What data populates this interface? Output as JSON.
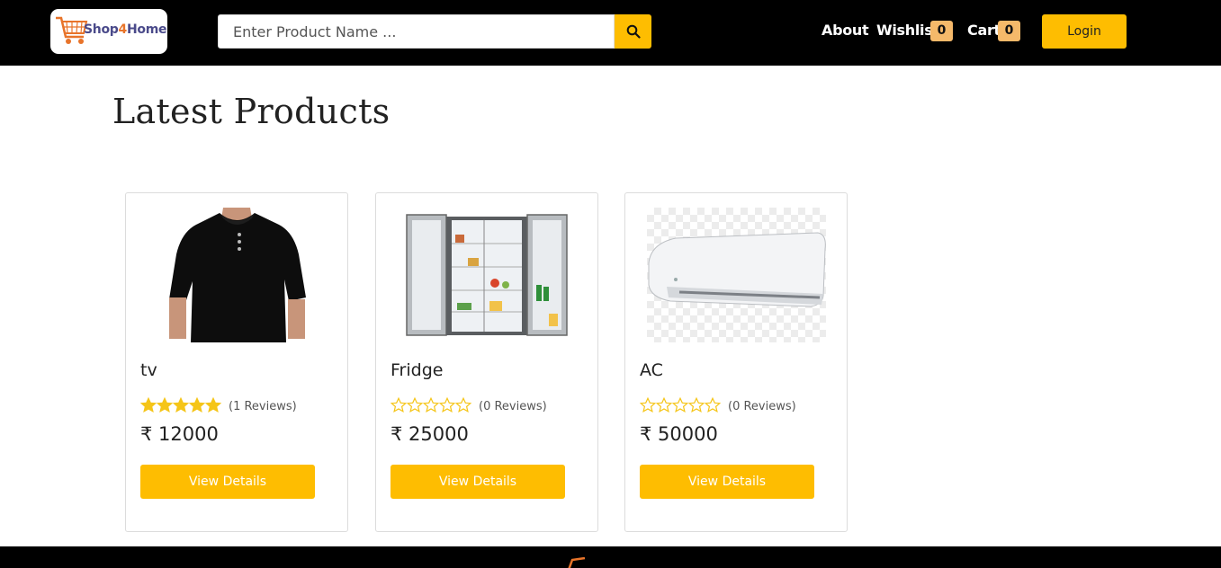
{
  "header": {
    "logo_text_a": "Shop",
    "logo_text_b": "4",
    "logo_text_c": "Home",
    "search_placeholder": "Enter Product Name ...",
    "nav": {
      "about": "About",
      "wishlist": "Wishlist",
      "wishlist_count": "0",
      "cart": "Cart",
      "cart_count": "0",
      "login": "Login"
    }
  },
  "main": {
    "title": "Latest Products",
    "products": [
      {
        "name": "tv",
        "rating": 5,
        "reviews": "(1 Reviews)",
        "price": "₹ 12000",
        "button": "View Details",
        "image": "black-tshirt-image"
      },
      {
        "name": "Fridge",
        "rating": 0,
        "reviews": "(0 Reviews)",
        "price": "₹ 25000",
        "button": "View Details",
        "image": "fridge-image"
      },
      {
        "name": "AC",
        "rating": 0,
        "reviews": "(0 Reviews)",
        "price": "₹ 50000",
        "button": "View Details",
        "image": "air-conditioner-image"
      }
    ]
  },
  "colors": {
    "accent": "#febd01",
    "header_bg": "#000000",
    "badge_bg": "#f5b96a",
    "star": "#f5c518"
  }
}
